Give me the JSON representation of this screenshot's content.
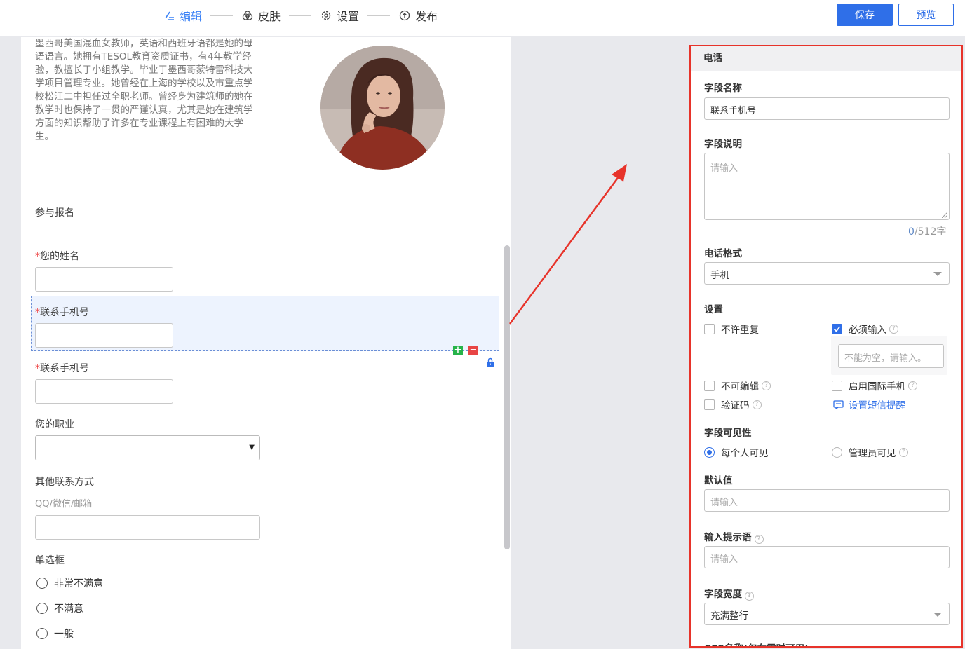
{
  "toolbar": {
    "steps": [
      {
        "label": "编辑",
        "icon": "edit-icon",
        "active": true
      },
      {
        "label": "皮肤",
        "icon": "palette-icon",
        "active": false
      },
      {
        "label": "设置",
        "icon": "gear-icon",
        "active": false
      },
      {
        "label": "发布",
        "icon": "publish-icon",
        "active": false
      }
    ],
    "save_label": "保存",
    "preview_label": "预览"
  },
  "form": {
    "bio": "墨西哥美国混血女教师，英语和西班牙语都是她的母语语言。她拥有TESOL教育资质证书，有4年教学经验，教擅长于小组教学。毕业于墨西哥蒙特雷科技大学项目管理专业。她曾经在上海的学校以及市重点学校松江二中担任过全职老师。曾经身为建筑师的她在教学时也保持了一贯的严谨认真，尤其是她在建筑学方面的知识帮助了许多在专业课程上有困难的大学生。",
    "section_title": "参与报名",
    "fields": [
      {
        "label": "您的姓名",
        "required": true
      },
      {
        "label": "联系手机号",
        "required": true
      },
      {
        "label": "联系手机号",
        "required": true
      },
      {
        "label": "您的职业",
        "required": false
      },
      {
        "label": "其他联系方式",
        "required": false,
        "hint": "QQ/微信/邮箱"
      },
      {
        "label": "单选框",
        "required": false
      }
    ],
    "required_mark": "*",
    "radio_options": [
      "非常不满意",
      "不满意",
      "一般"
    ],
    "add_symbol": "+",
    "remove_symbol": "−"
  },
  "panel": {
    "title": "电话",
    "field_name_label": "字段名称",
    "field_name_value": "联系手机号",
    "field_desc_label": "字段说明",
    "field_desc_placeholder": "请输入",
    "counter_num": "0",
    "counter_suffix": "/512字",
    "phone_format_label": "电话格式",
    "phone_format_value": "手机",
    "settings_label": "设置",
    "settings": [
      {
        "label": "不许重复",
        "checked": false
      },
      {
        "label": "必须输入",
        "checked": true
      },
      {
        "label": "不可编辑",
        "checked": false
      },
      {
        "label": "启用国际手机",
        "checked": false
      },
      {
        "label": "验证码",
        "checked": false
      }
    ],
    "required_placeholder": "不能为空，请输入。",
    "sms_link": "设置短信提醒",
    "visibility_label": "字段可见性",
    "visibility_options": [
      {
        "label": "每个人可见",
        "selected": true
      },
      {
        "label": "管理员可见",
        "selected": false
      }
    ],
    "default_label": "默认值",
    "default_placeholder": "请输入",
    "prompt_label": "输入提示语",
    "prompt_placeholder": "请输入",
    "width_label": "字段宽度",
    "width_value": "充满整行",
    "css_label": "CSS名称(仅在需时可用)"
  },
  "colors": {
    "accent": "#2f6fe8",
    "highlight_border": "#e7332a",
    "required": "#e44444"
  }
}
